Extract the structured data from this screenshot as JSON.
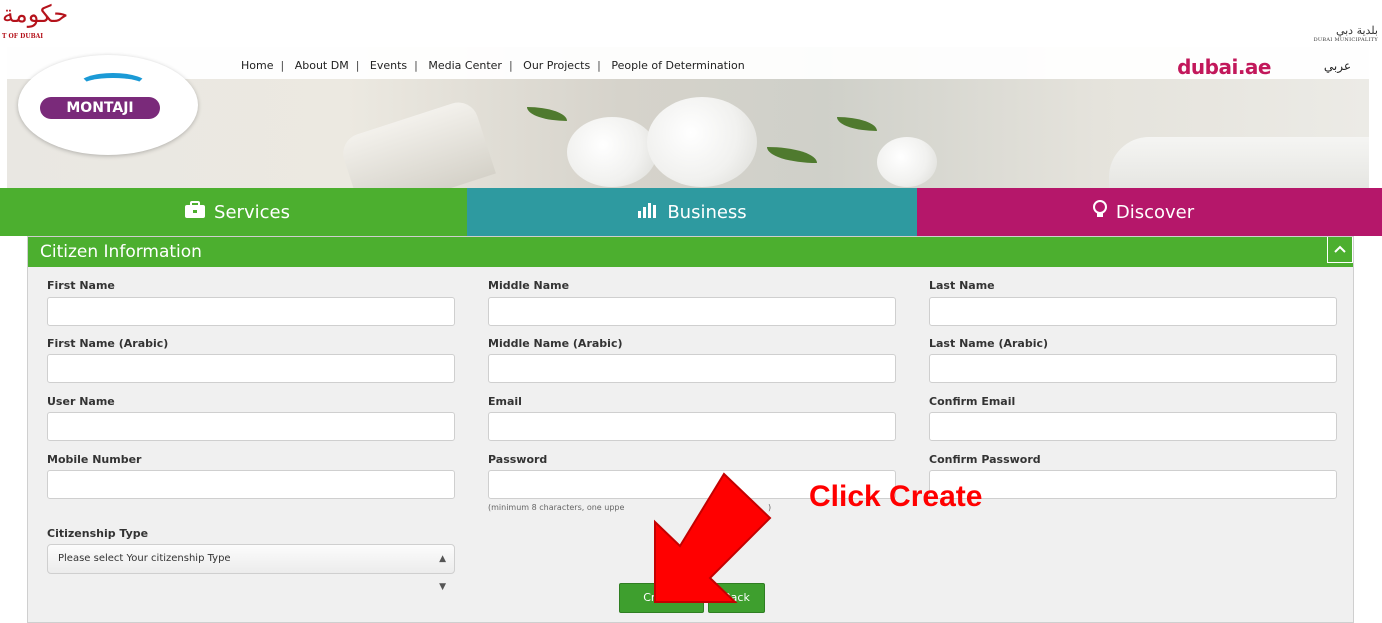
{
  "gov": {
    "left_logo_ar": "حكومة",
    "left_logo_en": "T OF DUBAI",
    "right_logo_ar": "بلدية دبي",
    "right_logo_en": "DUBAI MUNICIPALITY"
  },
  "header": {
    "brand": "MONTAJI",
    "nav": [
      "Home",
      "About DM",
      "Events",
      "Media Center",
      "Our Projects",
      "People of Determination"
    ],
    "dubai_ae": "dubai.ae",
    "language": "عربي"
  },
  "tabs": [
    {
      "label": "Services",
      "icon": "briefcase-icon",
      "color": "#4caf2f"
    },
    {
      "label": "Business",
      "icon": "bar-chart-icon",
      "color": "#2e9aa0"
    },
    {
      "label": "Discover",
      "icon": "lightbulb-icon",
      "color": "#b5176a"
    }
  ],
  "panel": {
    "title": "Citizen Information",
    "collapse_icon": "chevron-up-icon",
    "fields": {
      "first_name": {
        "label": "First Name",
        "value": ""
      },
      "middle_name": {
        "label": "Middle Name",
        "value": ""
      },
      "last_name": {
        "label": "Last Name",
        "value": ""
      },
      "first_name_ar": {
        "label": "First Name (Arabic)",
        "value": ""
      },
      "middle_name_ar": {
        "label": "Middle Name (Arabic)",
        "value": ""
      },
      "last_name_ar": {
        "label": "Last Name (Arabic)",
        "value": ""
      },
      "user_name": {
        "label": "User Name",
        "value": ""
      },
      "email": {
        "label": "Email",
        "value": ""
      },
      "confirm_email": {
        "label": "Confirm Email",
        "value": ""
      },
      "mobile": {
        "label": "Mobile Number",
        "value": ""
      },
      "password": {
        "label": "Password",
        "value": "",
        "hint": "(minimum 8 characters, one uppe"
      },
      "password_hint_tail": ")",
      "confirm_password": {
        "label": "Confirm Password",
        "value": ""
      },
      "citizenship": {
        "label": "Citizenship Type",
        "selected": "Please select Your citizenship Type"
      }
    },
    "create_label": "Create",
    "back_label": "Back"
  },
  "annotation": {
    "text": "Click Create",
    "color": "#ff0000"
  }
}
